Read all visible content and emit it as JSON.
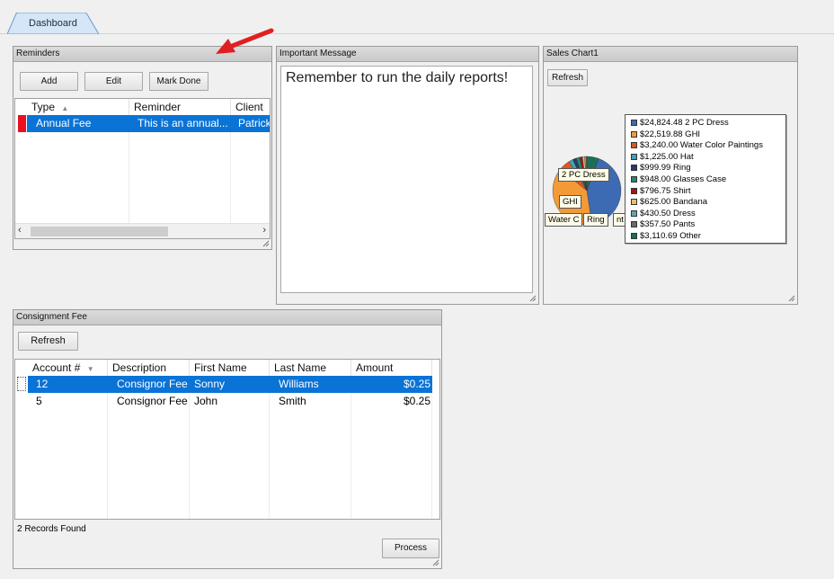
{
  "tab": {
    "label": "Dashboard"
  },
  "reminders": {
    "title": "Reminders",
    "buttons": {
      "add": "Add",
      "edit": "Edit",
      "mark_done": "Mark Done"
    },
    "columns": {
      "type": "Type",
      "reminder": "Reminder",
      "client": "Client"
    },
    "rows": [
      {
        "type": "Annual Fee",
        "reminder": "This is an annual...",
        "client": "Patrick"
      }
    ],
    "marker_color": "#e81123"
  },
  "message": {
    "title": "Important Message",
    "text": "Remember to run the daily reports!"
  },
  "sales": {
    "title": "Sales Chart1",
    "refresh": "Refresh",
    "pie_labels": {
      "dress": "2 PC Dress",
      "ghi": "GHI",
      "water": "Water C",
      "ring": "Ring",
      "nt": "nt"
    }
  },
  "chart_data": {
    "type": "pie",
    "title": "",
    "slices": [
      {
        "label": "$24,824.48 2 PC Dress",
        "value": 24824.48,
        "color": "#3d6bb3"
      },
      {
        "label": "$22,519.88 GHI",
        "value": 22519.88,
        "color": "#f29a38"
      },
      {
        "label": "$3,240.00 Water Color Paintings",
        "value": 3240.0,
        "color": "#e0561f"
      },
      {
        "label": "$1,225.00 Hat",
        "value": 1225.0,
        "color": "#45a0b5"
      },
      {
        "label": "$999.99 Ring",
        "value": 999.99,
        "color": "#2a3a6a"
      },
      {
        "label": "$948.00 Glasses Case",
        "value": 948.0,
        "color": "#218a6b"
      },
      {
        "label": "$796.75 Shirt",
        "value": 796.75,
        "color": "#9a1a1a"
      },
      {
        "label": "$625.00 Bandana",
        "value": 625.0,
        "color": "#e8c06a"
      },
      {
        "label": "$430.50 Dress",
        "value": 430.5,
        "color": "#5fa8b0"
      },
      {
        "label": "$357.50 Pants",
        "value": 357.5,
        "color": "#6a6a6a"
      },
      {
        "label": "$3,110.69 Other",
        "value": 3110.69,
        "color": "#1d6e55"
      }
    ],
    "legend": "right"
  },
  "consignment": {
    "title": "Consignment Fee",
    "refresh": "Refresh",
    "columns": {
      "account": "Account #",
      "description": "Description",
      "first": "First Name",
      "last": "Last Name",
      "amount": "Amount"
    },
    "rows": [
      {
        "account": "12",
        "description": "Consignor Fee",
        "first": "Sonny",
        "last": "Williams",
        "amount": "$0.25"
      },
      {
        "account": "5",
        "description": "Consignor Fee",
        "first": "John",
        "last": "Smith",
        "amount": "$0.25"
      }
    ],
    "status": "2 Records Found",
    "process": "Process"
  },
  "arrow_color": "#e02020"
}
